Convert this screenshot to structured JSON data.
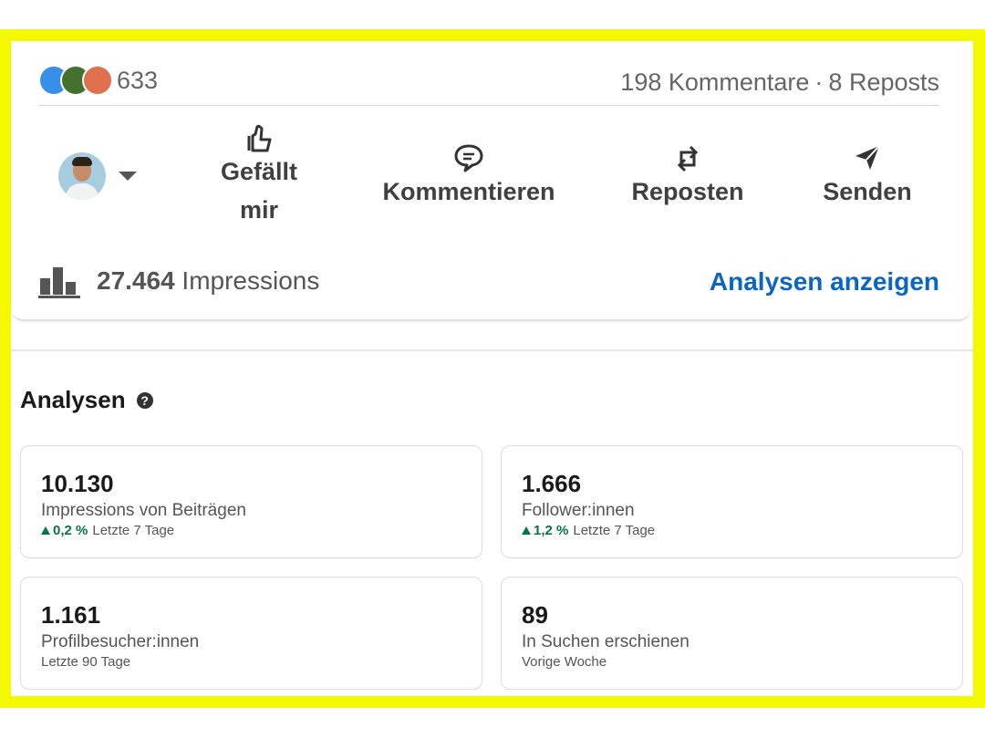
{
  "post": {
    "reaction_count": "633",
    "comments": "198 Kommentare",
    "dot": "·",
    "reposts": "8 Reposts",
    "actions": {
      "like": "Gefällt mir",
      "comment": "Kommentieren",
      "repost": "Reposten",
      "send": "Senden"
    },
    "impressions_value": "27.464",
    "impressions_label": "Impressions",
    "analytics_link": "Analysen anzeigen"
  },
  "analytics": {
    "title": "Analysen",
    "help_icon": "question-circle-icon",
    "cards": [
      {
        "value": "10.130",
        "label": "Impressions von Beiträgen",
        "trend": "0,2 %",
        "period": "Letzte 7 Tage"
      },
      {
        "value": "1.666",
        "label": "Follower:innen",
        "trend": "1,2 %",
        "period": "Letzte 7 Tage"
      },
      {
        "value": "1.161",
        "label": "Profilbesucher:innen",
        "period": "Letzte 90 Tage"
      },
      {
        "value": "89",
        "label": "In Suchen erschienen",
        "period": "Vorige Woche"
      }
    ]
  },
  "colors": {
    "highlight_frame": "#f5f900",
    "link_blue": "#0a66c2",
    "trend_green": "#057642"
  }
}
